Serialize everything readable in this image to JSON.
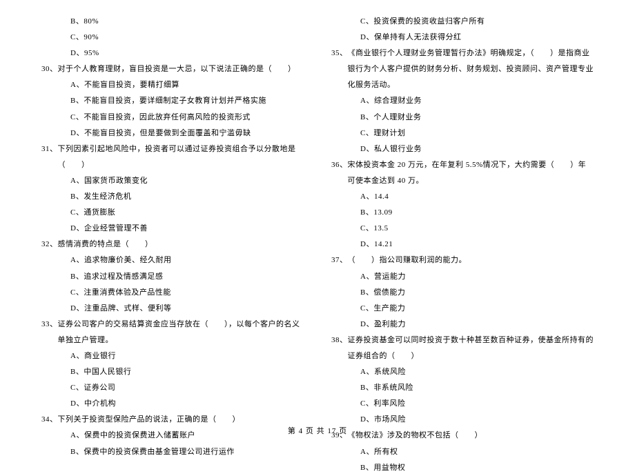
{
  "left_column": [
    {
      "type": "option",
      "text": "B、80%"
    },
    {
      "type": "option",
      "text": "C、90%"
    },
    {
      "type": "option",
      "text": "D、95%"
    },
    {
      "type": "question",
      "num": "30、",
      "text": "对于个人教育理财，盲目投资是一大忌，以下说法正确的是（　　）"
    },
    {
      "type": "option",
      "text": "A、不能盲目投资，要精打细算"
    },
    {
      "type": "option",
      "text": "B、不能盲目投资，要详细制定子女教育计划并严格实施"
    },
    {
      "type": "option",
      "text": "C、不能盲目投资，因此放弃任何高风险的投资形式"
    },
    {
      "type": "option",
      "text": "D、不能盲目投资，但是要做到全面覆盖和宁滥毋缺"
    },
    {
      "type": "question",
      "num": "31、",
      "text": "下列因素引起地风险中，投资者可以通过证券投资组合予以分散地是（　　）"
    },
    {
      "type": "option",
      "text": "A、国家货币政策变化"
    },
    {
      "type": "option",
      "text": "B、发生经济危机"
    },
    {
      "type": "option",
      "text": "C、通货膨胀"
    },
    {
      "type": "option",
      "text": "D、企业经营管理不善"
    },
    {
      "type": "question",
      "num": "32、",
      "text": "感情消费的特点是（　　）"
    },
    {
      "type": "option",
      "text": "A、追求物廉价美、经久耐用"
    },
    {
      "type": "option",
      "text": "B、追求过程及情感满足感"
    },
    {
      "type": "option",
      "text": "C、注重消费体验及产品性能"
    },
    {
      "type": "option",
      "text": "D、注重品牌、式样、便利等"
    },
    {
      "type": "question",
      "num": "33、",
      "text": "证券公司客户的交易结算资金应当存放在（　　），以每个客户的名义单独立户管理。"
    },
    {
      "type": "option",
      "text": "A、商业银行"
    },
    {
      "type": "option",
      "text": "B、中国人民银行"
    },
    {
      "type": "option",
      "text": "C、证券公司"
    },
    {
      "type": "option",
      "text": "D、中介机构"
    },
    {
      "type": "question",
      "num": "34、",
      "text": "下列关于投资型保险产品的说法，正确的是（　　）"
    },
    {
      "type": "option",
      "text": "A、保费中的投资保费进入储蓄账户"
    },
    {
      "type": "option",
      "text": "B、保费中的投资保费由基金管理公司进行运作"
    }
  ],
  "right_column": [
    {
      "type": "option",
      "text": "C、投资保费的投资收益归客户所有"
    },
    {
      "type": "option",
      "text": "D、保单持有人无法获得分红"
    },
    {
      "type": "question",
      "num": "35、",
      "text": "《商业银行个人理财业务管理暂行办法》明确规定，（　　）是指商业银行为个人客户提供的财务分析、财务规划、投资顾问、资产管理专业化服务活动。"
    },
    {
      "type": "option",
      "text": "A、综合理财业务"
    },
    {
      "type": "option",
      "text": "B、个人理财业务"
    },
    {
      "type": "option",
      "text": "C、理财计划"
    },
    {
      "type": "option",
      "text": "D、私人银行业务"
    },
    {
      "type": "question",
      "num": "36、",
      "text": "宋体投资本金 20 万元，在年复利 5.5%情况下，大约需要（　　）年可使本金达到 40 万。"
    },
    {
      "type": "option",
      "text": "A、14.4"
    },
    {
      "type": "option",
      "text": "B、13.09"
    },
    {
      "type": "option",
      "text": "C、13.5"
    },
    {
      "type": "option",
      "text": "D、14.21"
    },
    {
      "type": "question",
      "num": "37、",
      "text": "（　　）指公司赚取利润的能力。"
    },
    {
      "type": "option",
      "text": "A、营运能力"
    },
    {
      "type": "option",
      "text": "B、偿债能力"
    },
    {
      "type": "option",
      "text": "C、生产能力"
    },
    {
      "type": "option",
      "text": "D、盈利能力"
    },
    {
      "type": "question",
      "num": "38、",
      "text": "证券投资基金可以同时投资于数十种甚至数百种证券，使基金所持有的证券组合的（　　）"
    },
    {
      "type": "option",
      "text": "A、系统风险"
    },
    {
      "type": "option",
      "text": "B、非系统风险"
    },
    {
      "type": "option",
      "text": "C、利率风险"
    },
    {
      "type": "option",
      "text": "D、市场风险"
    },
    {
      "type": "question",
      "num": "39、",
      "text": "《物权法》涉及的物权不包括（　　）"
    },
    {
      "type": "option",
      "text": "A、所有权"
    },
    {
      "type": "option",
      "text": "B、用益物权"
    }
  ],
  "footer": "第 4 页 共 17 页"
}
